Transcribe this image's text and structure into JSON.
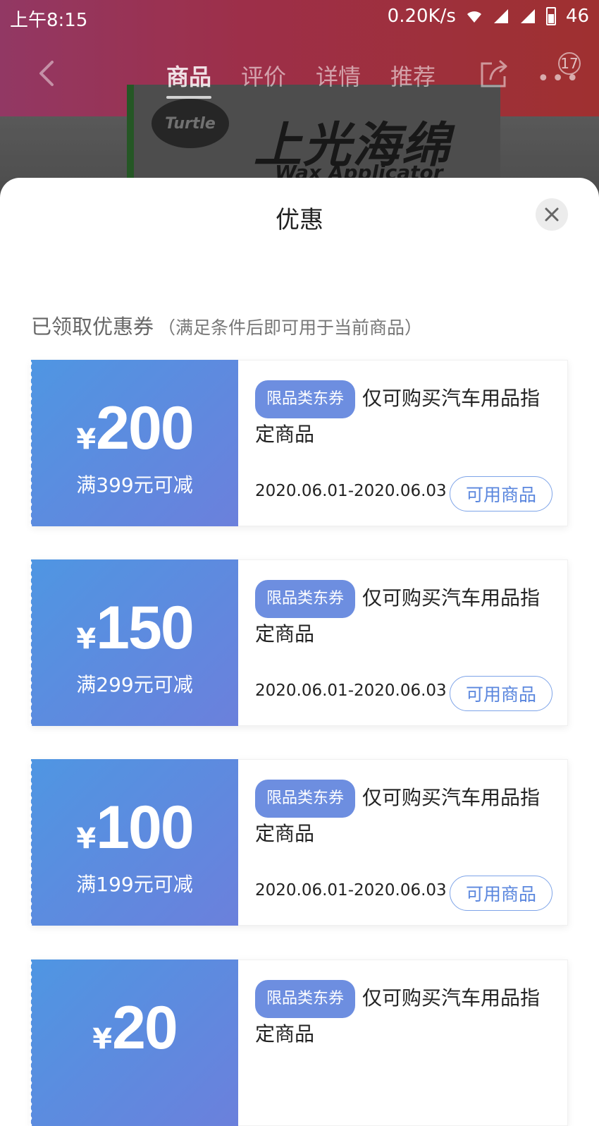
{
  "status_bar": {
    "time": "上午8:15",
    "network_speed": "0.20K/s",
    "battery": "46"
  },
  "nav": {
    "tabs": [
      {
        "label": "商品",
        "active": true
      },
      {
        "label": "评价",
        "active": false
      },
      {
        "label": "详情",
        "active": false
      },
      {
        "label": "推荐",
        "active": false
      }
    ],
    "message_badge": "17"
  },
  "background_product": {
    "logo_text": "Turtle",
    "title": "上光海绵",
    "subtitle": "Wax Applicator"
  },
  "sheet": {
    "title": "优惠",
    "section_title": "已领取优惠券",
    "section_note": "（满足条件后即可用于当前商品）"
  },
  "coupons": [
    {
      "currency": "¥",
      "amount": "200",
      "condition": "满399元可减",
      "tag": "限品类东券",
      "description": "仅可购买汽车用品指定商品",
      "validity": "2020.06.01-2020.06.03",
      "button": "可用商品"
    },
    {
      "currency": "¥",
      "amount": "150",
      "condition": "满299元可减",
      "tag": "限品类东券",
      "description": "仅可购买汽车用品指定商品",
      "validity": "2020.06.01-2020.06.03",
      "button": "可用商品"
    },
    {
      "currency": "¥",
      "amount": "100",
      "condition": "满199元可减",
      "tag": "限品类东券",
      "description": "仅可购买汽车用品指定商品",
      "validity": "2020.06.01-2020.06.03",
      "button": "可用商品"
    },
    {
      "currency": "¥",
      "amount": "20",
      "condition": "",
      "tag": "限品类东券",
      "description": "仅可购买汽车用品指定商品",
      "validity": "",
      "button": ""
    }
  ],
  "colors": {
    "coupon_gradient_start": "#4f96e2",
    "coupon_gradient_end": "#6b80dc",
    "tag_bg": "#6d8ee0",
    "button_border": "#7ea4e8",
    "header_red": "#c23b3b"
  }
}
